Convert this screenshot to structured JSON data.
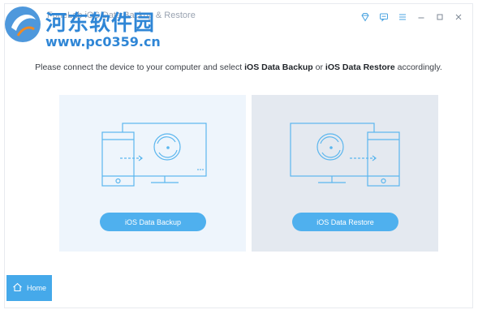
{
  "app": {
    "title": "FoneLab iOS Data Backup & Restore"
  },
  "watermark": {
    "cn_text": "河东软件园",
    "url": "www.pc0359.cn"
  },
  "instruction": {
    "prefix": "Please connect the device to your computer and select ",
    "backup_word": "iOS Data Backup",
    "middle": " or ",
    "restore_word": "iOS Data Restore",
    "suffix": " accordingly."
  },
  "panels": {
    "backup": {
      "button_label": "iOS Data Backup"
    },
    "restore": {
      "button_label": "iOS Data Restore"
    }
  },
  "home": {
    "label": "Home"
  },
  "icons": {
    "diamond": "diamond-icon",
    "feedback": "chat-icon",
    "menu": "menu-icon",
    "minimize": "minimize-icon",
    "maximize": "maximize-icon",
    "close": "close-icon",
    "home": "home-icon"
  },
  "colors": {
    "accent": "#4fb0ee",
    "home_bg": "#45a9ea",
    "line": "#5bb6ee"
  }
}
